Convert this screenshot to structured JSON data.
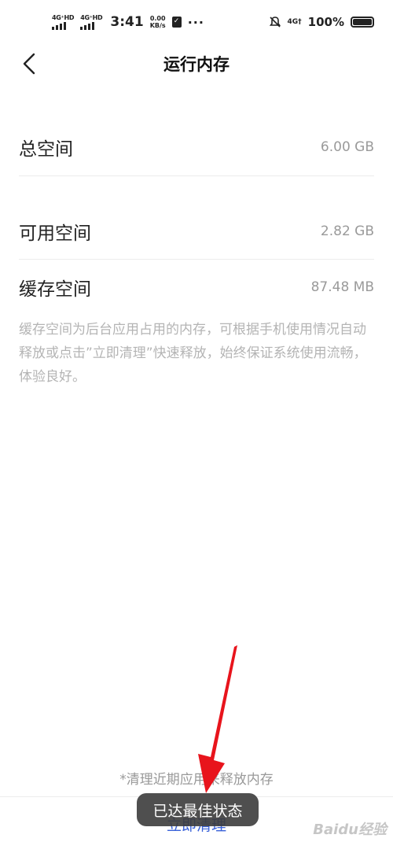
{
  "status_bar": {
    "sim1_label": "4G⁺HD",
    "sim2_label": "4G⁺HD",
    "time": "3:41",
    "speed_value": "0.00",
    "speed_unit": "KB/s",
    "more": "···",
    "net_label": "4G†",
    "battery": "100%"
  },
  "header": {
    "title": "运行内存"
  },
  "rows": [
    {
      "label": "总空间",
      "value": "6.00 GB"
    },
    {
      "label": "可用空间",
      "value": "2.82 GB"
    },
    {
      "label": "缓存空间",
      "value": "87.48 MB"
    }
  ],
  "description": "缓存空间为后台应用占用的内存，可根据手机使用情况自动释放或点击”立即清理”快速释放，始终保证系统使用流畅，体验良好。",
  "bottom": {
    "hint": "*清理近期应用来释放内存",
    "clean_button": "立即清理",
    "toast": "已达最佳状态"
  },
  "watermark": "Baidu经验",
  "colors": {
    "accent": "#3a62d9",
    "annotation_arrow": "#e8141c"
  }
}
